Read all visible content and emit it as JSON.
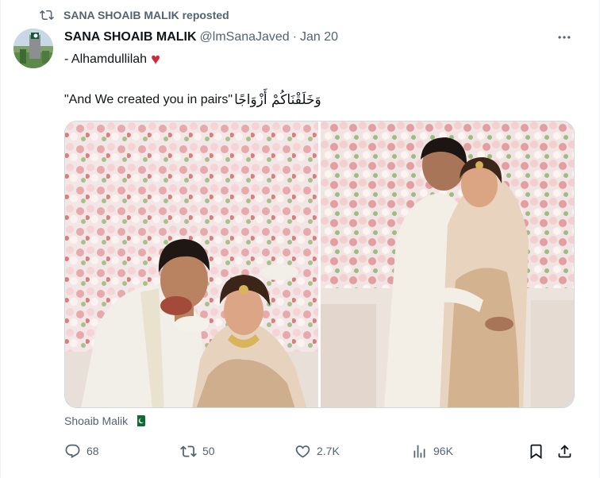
{
  "repost": {
    "label": "SANA SHOAIB MALIK reposted",
    "icon": "repost-icon"
  },
  "author": {
    "display_name": "SANA SHOAIB MALIK",
    "handle": "@lmSanaJaved",
    "separator": "·",
    "date": "Jan 20",
    "avatar_icon": "pakistan-flag-avatar"
  },
  "post": {
    "line1_text": "- Alhamdullilah",
    "line1_emoji": "♥",
    "line2_text": "\"And We created you in pairs\"",
    "line2_arabic": "وَخَلَقْنَاكُمْ أَزْوَاجًا"
  },
  "media": {
    "count": 2,
    "photos": [
      "couple-photo-smiling",
      "couple-photo-embrace"
    ]
  },
  "tag": {
    "name": "Shoaib Malik",
    "flag_icon": "pakistan-flag-icon"
  },
  "actions": {
    "replies": "68",
    "reposts": "50",
    "likes": "2.7K",
    "views": "96K"
  },
  "colors": {
    "text_primary": "#0f1419",
    "text_secondary": "#536471",
    "heart": "#d1283a",
    "border": "#cfd9de"
  }
}
